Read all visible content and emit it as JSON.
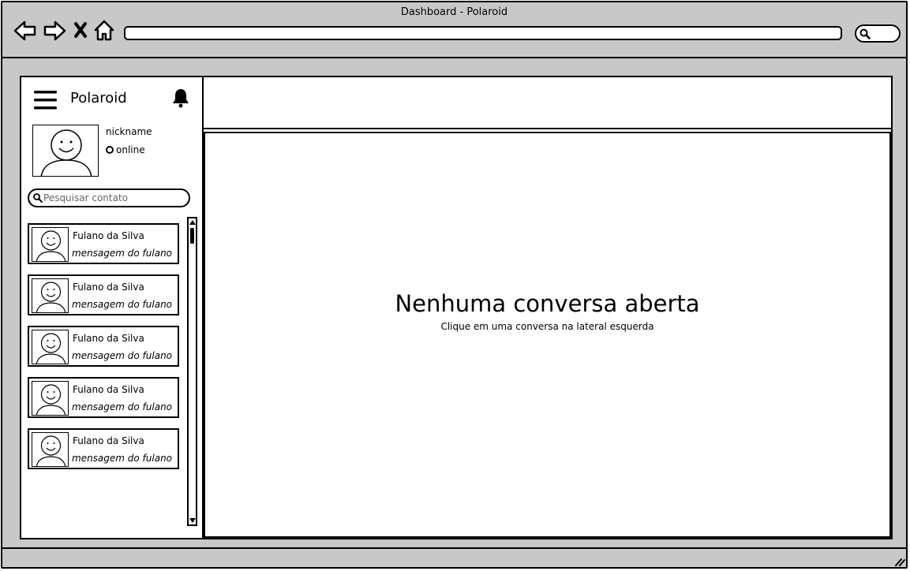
{
  "window": {
    "title": "Dashboard - Polaroid"
  },
  "browser": {
    "back_icon": "arrow-left-icon",
    "forward_icon": "arrow-right-icon",
    "stop_icon": "close-icon",
    "home_icon": "home-icon",
    "search_icon": "search-icon",
    "url": ""
  },
  "sidebar": {
    "menu_icon": "hamburger-menu-icon",
    "app_name": "Polaroid",
    "bell_icon": "bell-icon",
    "profile": {
      "nickname": "nickname",
      "status": "online"
    },
    "search": {
      "placeholder": "Pesquisar contato",
      "value": ""
    },
    "contacts": [
      {
        "name": "Fulano da Silva",
        "message": "mensagem do fulano"
      },
      {
        "name": "Fulano da Silva",
        "message": "mensagem do fulano"
      },
      {
        "name": "Fulano da Silva",
        "message": "mensagem do fulano"
      },
      {
        "name": "Fulano da Silva",
        "message": "mensagem do fulano"
      },
      {
        "name": "Fulano da Silva",
        "message": "mensagem do fulano"
      }
    ]
  },
  "main": {
    "empty_title": "Nenhuma conversa aberta",
    "empty_subtitle": "Clique em uma conversa na lateral esquerda"
  },
  "colors": {
    "chrome": "#c8c8c8",
    "ink": "#000000",
    "panel": "#ffffff"
  }
}
